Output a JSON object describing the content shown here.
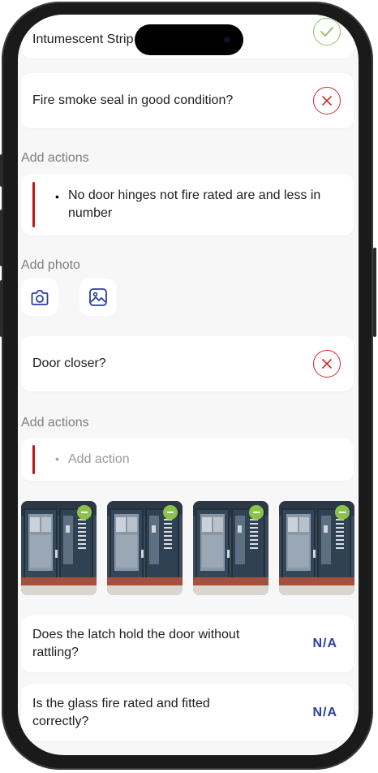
{
  "questions": {
    "intumescent": {
      "text": "Intumescent Strip in good condition?",
      "status": "ok"
    },
    "fire_smoke_seal": {
      "text": "Fire smoke seal in good condition?",
      "status": "fail"
    },
    "door_closer": {
      "text": "Door closer?",
      "status": "fail"
    },
    "latch": {
      "text": "Does the latch hold the door without rattling?",
      "answer": "N/A"
    },
    "glass": {
      "text": "Is the glass fire rated and fitted correctly?",
      "answer": "N/A"
    }
  },
  "actions_1": {
    "label": "Add actions",
    "items": [
      "No door hinges not fire rated are and less in number"
    ]
  },
  "photo": {
    "label": "Add photo",
    "buttons": [
      "camera-icon",
      "gallery-icon"
    ]
  },
  "actions_2": {
    "label": "Add actions",
    "placeholder": "Add action"
  },
  "photos": {
    "count": 4
  },
  "colors": {
    "ok": "#8cbf6a",
    "fail": "#d02a2a",
    "accent_bar": "#c4161c",
    "na": "#2b3fa3",
    "icon_blue": "#2b3fa3"
  }
}
